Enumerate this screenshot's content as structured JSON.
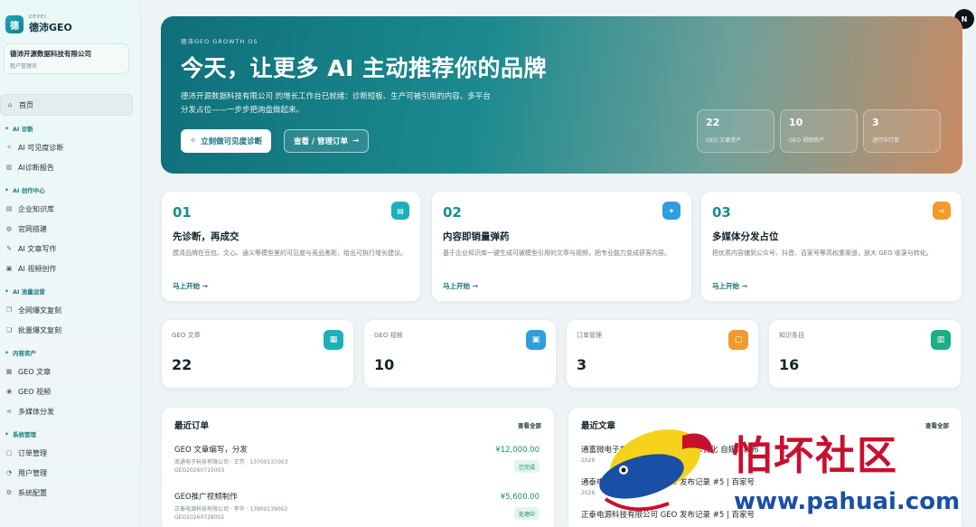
{
  "brand": {
    "eyebrow": "DEPEI",
    "name": "德沛GEO",
    "logo_char": "德"
  },
  "company": {
    "name": "德沛开源数据科技有限公司",
    "role": "租户管理员"
  },
  "nav": {
    "home": "首页",
    "sections": [
      {
        "title": "AI 诊断",
        "items": [
          "AI 可见度诊断",
          "AI诊断报告"
        ]
      },
      {
        "title": "AI 创作中心",
        "items": [
          "企业知识库",
          "官网搭建",
          "AI 文章写作",
          "AI 视频创作"
        ]
      },
      {
        "title": "AI 流量运营",
        "items": [
          "全网爆文复刻",
          "批量爆文复刻"
        ]
      },
      {
        "title": "内容资产",
        "items": [
          "GEO 文章",
          "GEO 视频",
          "多媒体分发"
        ]
      },
      {
        "title": "系统管理",
        "items": [
          "订单管理",
          "用户管理",
          "系统配置"
        ]
      }
    ]
  },
  "avatar": "N",
  "hero": {
    "eyebrow": "德沛GEO GROWTH OS",
    "title": "今天，让更多 AI 主动推荐你的品牌",
    "description": "德沛开源数据科技有限公司 的增长工作台已就绪：诊断短板、生产可被引用的内容、多平台分发占位——一步步把询盘做起来。",
    "primary_button": "立刻做可见度诊断",
    "secondary_button": "查看 / 管理订单",
    "stats": [
      {
        "value": "22",
        "label": "GEO 文章资产"
      },
      {
        "value": "10",
        "label": "GEO 视频资产"
      },
      {
        "value": "3",
        "label": "进行中订单"
      }
    ]
  },
  "steps": [
    {
      "num": "01",
      "title": "先诊断，再成交",
      "desc": "摸清品牌在豆包、文心、通义等模型里的可见度与竞品差距，给出可执行增长建议。",
      "link": "马上开始",
      "icon": "document-icon",
      "color": "#1bb1b8"
    },
    {
      "num": "02",
      "title": "内容即销量弹药",
      "desc": "基于企业知识库一键生成可被模型引用的文章与视频，把专业能力变成获客内容。",
      "link": "马上开始",
      "icon": "wand-icon",
      "color": "#2e9ee0"
    },
    {
      "num": "03",
      "title": "多媒体分发占位",
      "desc": "把优质内容铺到公众号、抖音、百家号等高权重渠道，放大 GEO 收录与转化。",
      "link": "马上开始",
      "icon": "share-icon",
      "color": "#f29a2e"
    }
  ],
  "metrics": [
    {
      "label": "GEO 文章",
      "value": "22",
      "icon": "article-icon",
      "color": "#1bb1b8"
    },
    {
      "label": "GEO 视频",
      "value": "10",
      "icon": "video-icon",
      "color": "#2e9ee0"
    },
    {
      "label": "订单管理",
      "value": "3",
      "icon": "order-icon",
      "color": "#f29a2e"
    },
    {
      "label": "知识条目",
      "value": "16",
      "icon": "book-icon",
      "color": "#1aae84"
    }
  ],
  "orders": {
    "title": "最近订单",
    "view_all": "查看全部",
    "rows": [
      {
        "title": "GEO 文章编写，分发",
        "sub": "南通电子科技有限公司 · 王芳 · 13700137003",
        "code": "GEO20260715003",
        "amount": "¥12,000.00",
        "status": "已完成"
      },
      {
        "title": "GEO推广视频制作",
        "sub": "正泰电源科技有限公司 · 李华 · 13900139002",
        "code": "GEO20260728002",
        "amount": "¥5,600.00",
        "status": "处理中"
      }
    ]
  },
  "articles": {
    "title": "最近文章",
    "view_all": "查看全部",
    "rows": [
      {
        "title": "通富微电子有限公司 GEO 搜索引擎优化 自媒体发布",
        "sub": "2026"
      },
      {
        "title": "通泰电源科技有限公司 GEO 发布记录 #5 | 百家号",
        "sub": "2026"
      },
      {
        "title": "正泰电源科技有限公司 GEO 发布记录 #5 | 百家号",
        "sub": ""
      }
    ]
  },
  "watermark": {
    "title": "怕坏社区",
    "url": "www.pahuai.com"
  }
}
